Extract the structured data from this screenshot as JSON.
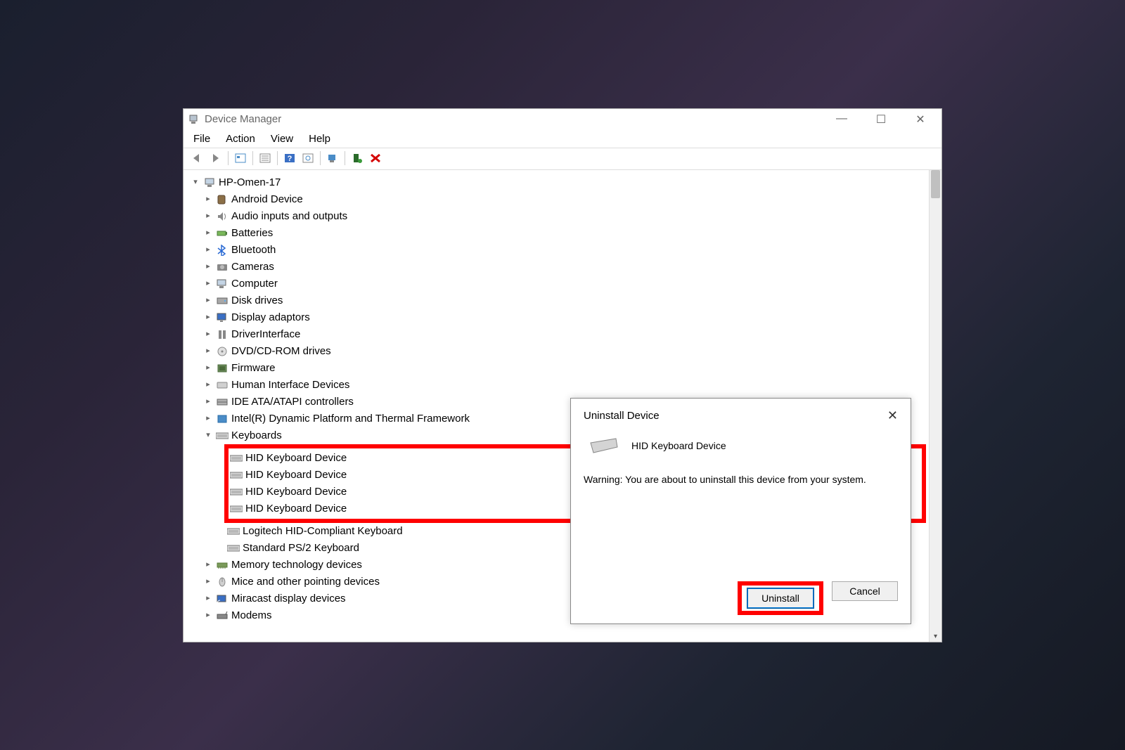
{
  "window_title": "Device Manager",
  "menu": {
    "file": "File",
    "action": "Action",
    "view": "View",
    "help": "Help"
  },
  "tree": {
    "root": "HP-Omen-17",
    "items": [
      {
        "label": "Android Device",
        "icon": "android"
      },
      {
        "label": "Audio inputs and outputs",
        "icon": "audio"
      },
      {
        "label": "Batteries",
        "icon": "battery"
      },
      {
        "label": "Bluetooth",
        "icon": "bluetooth"
      },
      {
        "label": "Cameras",
        "icon": "camera"
      },
      {
        "label": "Computer",
        "icon": "computer"
      },
      {
        "label": "Disk drives",
        "icon": "disk"
      },
      {
        "label": "Display adaptors",
        "icon": "display"
      },
      {
        "label": "DriverInterface",
        "icon": "driver"
      },
      {
        "label": "DVD/CD-ROM drives",
        "icon": "dvd"
      },
      {
        "label": "Firmware",
        "icon": "firmware"
      },
      {
        "label": "Human Interface Devices",
        "icon": "hid"
      },
      {
        "label": "IDE ATA/ATAPI controllers",
        "icon": "ide"
      },
      {
        "label": "Intel(R) Dynamic Platform and Thermal Framework",
        "icon": "intel"
      }
    ],
    "keyboards_label": "Keyboards",
    "keyboard_children": [
      "HID Keyboard Device",
      "HID Keyboard Device",
      "HID Keyboard Device",
      "HID Keyboard Device"
    ],
    "keyboard_tail": [
      "Logitech HID-Compliant Keyboard",
      "Standard PS/2 Keyboard"
    ],
    "items2": [
      {
        "label": "Memory technology devices",
        "icon": "memory"
      },
      {
        "label": "Mice and other pointing devices",
        "icon": "mouse"
      },
      {
        "label": "Miracast display devices",
        "icon": "miracast"
      },
      {
        "label": "Modems",
        "icon": "modem"
      }
    ]
  },
  "dialog": {
    "title": "Uninstall Device",
    "device": "HID Keyboard Device",
    "warning": "Warning: You are about to uninstall this device from your system.",
    "uninstall": "Uninstall",
    "cancel": "Cancel"
  }
}
